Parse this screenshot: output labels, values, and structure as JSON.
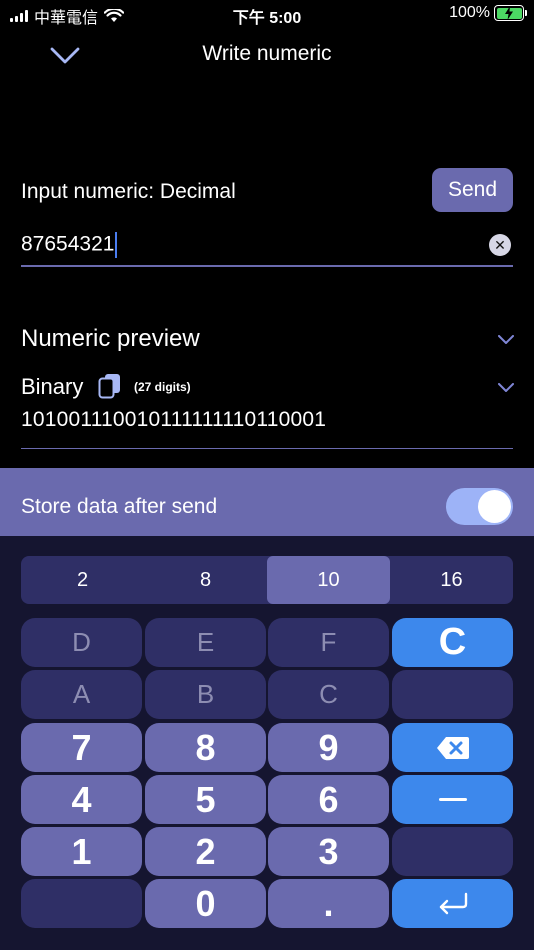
{
  "status": {
    "carrier": "中華電信",
    "time": "下午 5:00",
    "battery": "100%",
    "colors": {
      "battery_fill": "#4cd964"
    }
  },
  "nav": {
    "title": "Write numeric",
    "back_icon": "chevron-down-icon"
  },
  "input": {
    "label": "Input numeric: Decimal",
    "send_label": "Send",
    "value": "87654321",
    "clear_icon": "clear-icon"
  },
  "preview": {
    "title": "Numeric preview",
    "format_label": "Binary",
    "digits_note": "(27 digits)",
    "value": "101001110010111111110110001"
  },
  "store": {
    "label": "Store data after send",
    "enabled": true
  },
  "keyboard": {
    "radix": [
      {
        "label": "2",
        "active": false
      },
      {
        "label": "8",
        "active": false
      },
      {
        "label": "10",
        "active": true
      },
      {
        "label": "16",
        "active": false
      }
    ],
    "hex_keys": [
      "D",
      "E",
      "F",
      "A",
      "B",
      "C"
    ],
    "clear_key": "C",
    "digit_keys": [
      "7",
      "8",
      "9",
      "4",
      "5",
      "6",
      "1",
      "2",
      "3",
      "0",
      "."
    ],
    "icons": [
      "backspace-icon",
      "minus-icon",
      "return-icon"
    ]
  },
  "colors": {
    "accent": "#6a6aae",
    "keyboard_bg": "#151530",
    "key_dark": "#2f2f66",
    "key_blue": "#3d88ec",
    "toggle_on": "#9db3f7"
  }
}
